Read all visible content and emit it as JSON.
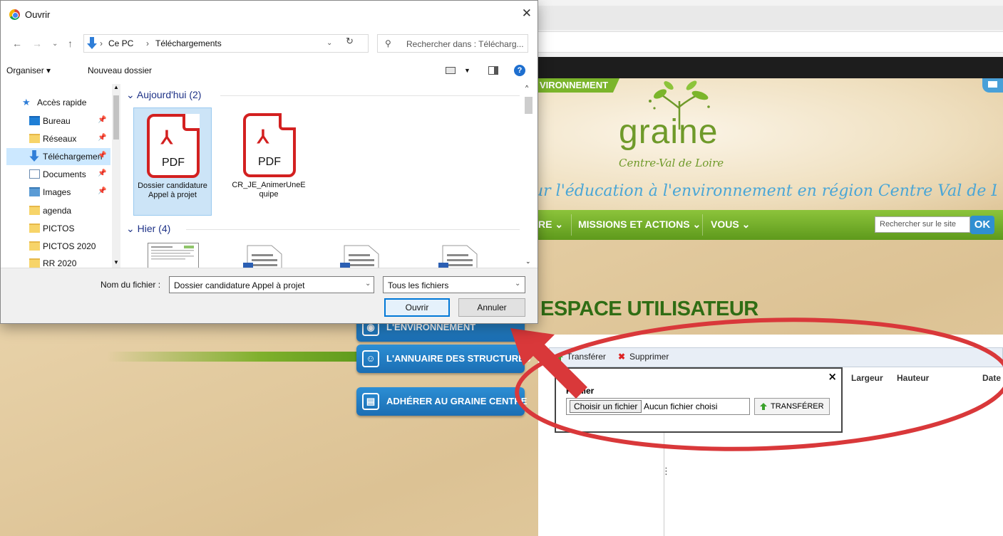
{
  "dialog": {
    "title": "Ouvrir",
    "close": "✕",
    "breadcrumb": [
      "Ce PC",
      "Téléchargements"
    ],
    "search_placeholder": "Rechercher dans : Télécharg...",
    "organiser": "Organiser ▾",
    "nouveau_dossier": "Nouveau dossier",
    "help": "?",
    "nav_items": [
      {
        "label": "Accès rapide",
        "pinned": false
      },
      {
        "label": "Bureau",
        "pinned": true
      },
      {
        "label": "Réseaux",
        "pinned": true
      },
      {
        "label": "Téléchargements",
        "pinned": true
      },
      {
        "label": "Documents",
        "pinned": true
      },
      {
        "label": "Images",
        "pinned": true
      },
      {
        "label": "agenda",
        "pinned": false
      },
      {
        "label": "PICTOS",
        "pinned": false
      },
      {
        "label": "PICTOS 2020",
        "pinned": false
      },
      {
        "label": "RR 2020",
        "pinned": false
      }
    ],
    "groups": {
      "today": "Aujourd'hui (2)",
      "yesterday": "Hier (4)"
    },
    "files": [
      {
        "name": "Dossier candidature Appel à projet",
        "type": "PDF",
        "selected": true
      },
      {
        "name": "CR_JE_AnimerUneEquipe",
        "type": "PDF",
        "selected": false
      }
    ],
    "filename_label": "Nom du fichier :",
    "filename_value": "Dossier candidature Appel à projet",
    "filetype_value": "Tous les fichiers",
    "open_button": "Ouvrir",
    "cancel_button": "Annuler"
  },
  "site": {
    "env_tab": "VIRONNEMENT",
    "logo": "graine",
    "logo_sub": "Centre-Val de Loire",
    "tagline": "ur l'éducation à l'environnement en région Centre Val de Loire",
    "nav": [
      "RE ⌄",
      "MISSIONS ET ACTIONS ⌄",
      "VOUS ⌄"
    ],
    "search_placeholder": "Rechercher sur le site",
    "search_ok": "OK",
    "heading": "ESPACE UTILISATEUR",
    "side_buttons": [
      "L'ENVIRONNEMENT",
      "L'ANNUAIRE DES STRUCTURES",
      "ADHÉRER AU GRAINE CENTRE"
    ]
  },
  "file_manager": {
    "transfer": "Transférer",
    "delete": "Supprimer",
    "columns": [
      "Largeur",
      "Hauteur",
      "Date"
    ],
    "upload_label": "Fichier",
    "choose_button": "Choisir un fichier",
    "no_file": "Aucun fichier choisi",
    "upload_button": "TRANSFÉRER",
    "close": "×"
  },
  "colors": {
    "brand_green": "#6f9a2a",
    "nav_green": "#5e9a1c",
    "button_blue": "#1b6eb3",
    "annotation_red": "#d9383a",
    "selection_blue": "#cce4f7"
  }
}
